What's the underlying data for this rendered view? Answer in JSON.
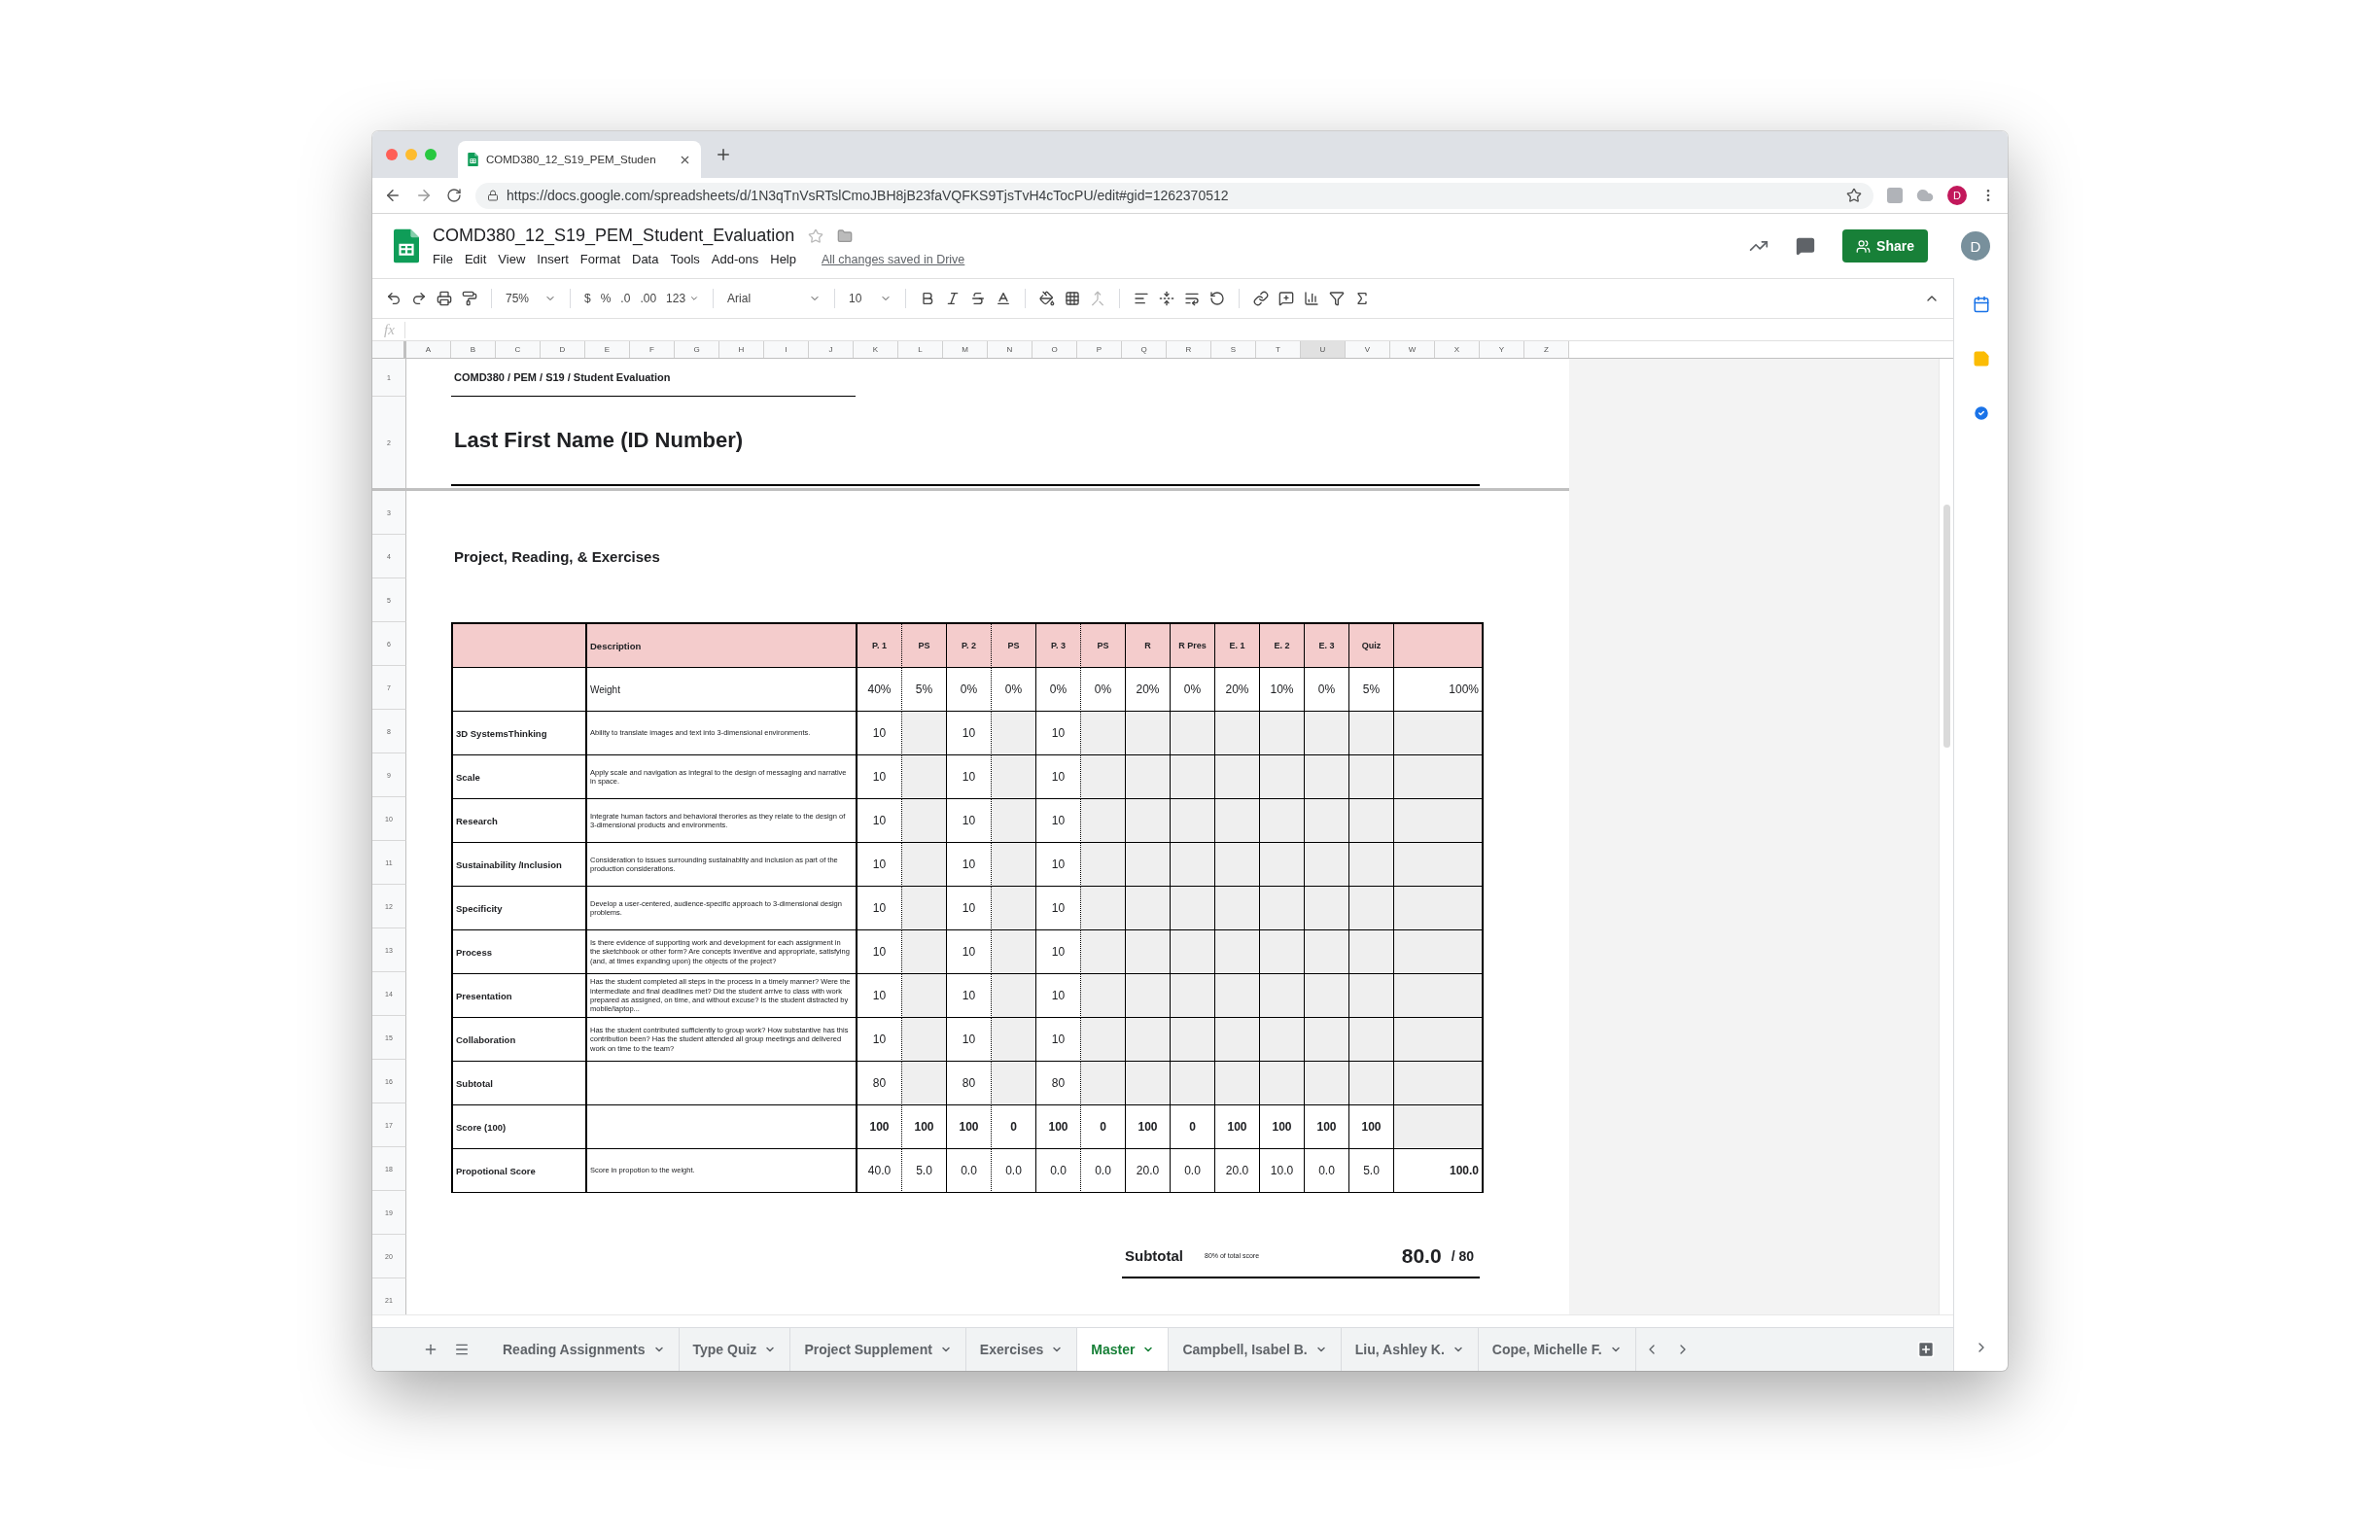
{
  "browser": {
    "tab_title": "COMD380_12_S19_PEM_Studen",
    "url": "https://docs.google.com/spreadsheets/d/1N3qTnVsRTslCmoJBH8jB23faVQFKS9TjsTvH4cTocPU/edit#gid=1262370512",
    "profile": "D"
  },
  "document": {
    "title": "COMD380_12_S19_PEM_Student_Evaluation",
    "starred": false,
    "menus": [
      "File",
      "Edit",
      "View",
      "Insert",
      "Format",
      "Data",
      "Tools",
      "Add-ons",
      "Help"
    ],
    "save_status": "All changes saved in Drive",
    "share_label": "Share",
    "avatar": "D"
  },
  "toolbar": {
    "zoom": "75%",
    "currency": "$",
    "percent": "%",
    "decimal_decrease": ".0",
    "decimal_increase": ".00",
    "number_format": "123",
    "font": "Arial",
    "font_size": "10"
  },
  "formula_bar": {
    "label": "fx"
  },
  "columns": [
    {
      "label": "A",
      "selected": false
    },
    {
      "label": "B",
      "selected": false
    },
    {
      "label": "C",
      "selected": false
    },
    {
      "label": "D",
      "selected": false
    },
    {
      "label": "E",
      "selected": false
    },
    {
      "label": "F",
      "selected": false
    },
    {
      "label": "G",
      "selected": false
    },
    {
      "label": "H",
      "selected": false
    },
    {
      "label": "I",
      "selected": false
    },
    {
      "label": "J",
      "selected": false
    },
    {
      "label": "K",
      "selected": false
    },
    {
      "label": "L",
      "selected": false
    },
    {
      "label": "M",
      "selected": false
    },
    {
      "label": "N",
      "selected": false
    },
    {
      "label": "O",
      "selected": false
    },
    {
      "label": "P",
      "selected": false
    },
    {
      "label": "Q",
      "selected": false
    },
    {
      "label": "R",
      "selected": false
    },
    {
      "label": "S",
      "selected": false
    },
    {
      "label": "T",
      "selected": false
    },
    {
      "label": "U",
      "selected": true
    },
    {
      "label": "V",
      "selected": false
    },
    {
      "label": "W",
      "selected": false
    },
    {
      "label": "X",
      "selected": false
    },
    {
      "label": "Y",
      "selected": false
    },
    {
      "label": "Z",
      "selected": false
    }
  ],
  "row_numbers": [
    "1",
    "2",
    "3",
    "4",
    "5",
    "6",
    "7",
    "8",
    "9",
    "10",
    "11",
    "12",
    "13",
    "14",
    "15",
    "16",
    "17",
    "18",
    "19",
    "20",
    "21"
  ],
  "sheet": {
    "breadcrumb": "COMD380 / PEM / S19 / Student Evaluation",
    "student_name": "Last First Name (ID Number)",
    "section_title": "Project, Reading, & Exercises",
    "table": {
      "header": {
        "description": "Description",
        "columns": [
          {
            "label": "P. 1",
            "kind": "project"
          },
          {
            "label": "PS",
            "kind": "supplement"
          },
          {
            "label": "P. 2",
            "kind": "project"
          },
          {
            "label": "PS",
            "kind": "supplement"
          },
          {
            "label": "P. 3",
            "kind": "project"
          },
          {
            "label": "PS",
            "kind": "supplement"
          },
          {
            "label": "R",
            "kind": "single"
          },
          {
            "label": "R Pres",
            "kind": "single"
          },
          {
            "label": "E. 1",
            "kind": "single"
          },
          {
            "label": "E. 2",
            "kind": "single"
          },
          {
            "label": "E. 3",
            "kind": "single"
          },
          {
            "label": "Quiz",
            "kind": "single"
          },
          {
            "kind": "total"
          }
        ]
      },
      "rows": [
        {
          "kind": "weight",
          "description": "Weight",
          "values": [
            "40%",
            "5%",
            "0%",
            "0%",
            "0%",
            "0%",
            "20%",
            "0%",
            "20%",
            "10%",
            "0%",
            "5%",
            "100%"
          ]
        },
        {
          "kind": "criterion",
          "label": "3D SystemsThinking",
          "description": "Ability to translate images and text into 3-dimensional environments.",
          "values": [
            "10",
            {
              "kind": "blank"
            },
            "10",
            {
              "kind": "blank"
            },
            "10",
            {
              "kind": "blank"
            },
            {
              "kind": "blank"
            },
            {
              "kind": "blank"
            },
            {
              "kind": "blank"
            },
            {
              "kind": "blank"
            },
            {
              "kind": "blank"
            },
            {
              "kind": "blank"
            },
            {
              "kind": "blank"
            }
          ]
        },
        {
          "kind": "criterion",
          "label": "Scale",
          "description": "Apply scale and navigation as integral to the design of messaging and narrative in space.",
          "values": [
            "10",
            {
              "kind": "blank"
            },
            "10",
            {
              "kind": "blank"
            },
            "10",
            {
              "kind": "blank"
            },
            {
              "kind": "blank"
            },
            {
              "kind": "blank"
            },
            {
              "kind": "blank"
            },
            {
              "kind": "blank"
            },
            {
              "kind": "blank"
            },
            {
              "kind": "blank"
            },
            {
              "kind": "blank"
            }
          ]
        },
        {
          "kind": "criterion",
          "label": "Research",
          "description": "Integrate human factors and behavioral therories as they relate to the design of 3-dimensional products and environments.",
          "values": [
            "10",
            {
              "kind": "blank"
            },
            "10",
            {
              "kind": "blank"
            },
            "10",
            {
              "kind": "blank"
            },
            {
              "kind": "blank"
            },
            {
              "kind": "blank"
            },
            {
              "kind": "blank"
            },
            {
              "kind": "blank"
            },
            {
              "kind": "blank"
            },
            {
              "kind": "blank"
            },
            {
              "kind": "blank"
            }
          ]
        },
        {
          "kind": "criterion",
          "label": "Sustainability /Inclusion",
          "description": "Consideration to issues surrounding sustainablity and inclusion as part of the production considerations.",
          "values": [
            "10",
            {
              "kind": "blank"
            },
            "10",
            {
              "kind": "blank"
            },
            "10",
            {
              "kind": "blank"
            },
            {
              "kind": "blank"
            },
            {
              "kind": "blank"
            },
            {
              "kind": "blank"
            },
            {
              "kind": "blank"
            },
            {
              "kind": "blank"
            },
            {
              "kind": "blank"
            },
            {
              "kind": "blank"
            }
          ]
        },
        {
          "kind": "criterion",
          "label": "Specificity",
          "description": "Develop a user-centered, audience-specific approach to 3-dimensional design problems.",
          "values": [
            "10",
            {
              "kind": "blank"
            },
            "10",
            {
              "kind": "blank"
            },
            "10",
            {
              "kind": "blank"
            },
            {
              "kind": "blank"
            },
            {
              "kind": "blank"
            },
            {
              "kind": "blank"
            },
            {
              "kind": "blank"
            },
            {
              "kind": "blank"
            },
            {
              "kind": "blank"
            },
            {
              "kind": "blank"
            }
          ]
        },
        {
          "kind": "criterion",
          "label": "Process",
          "description": "Is there evidence of supporting work and development for each assignment in the sketchbook or other form? Are concepts inventive and appropriate, satisfying (and, at times expanding upon) the objects of the project?",
          "values": [
            "10",
            {
              "kind": "blank"
            },
            "10",
            {
              "kind": "blank"
            },
            "10",
            {
              "kind": "blank"
            },
            {
              "kind": "blank"
            },
            {
              "kind": "blank"
            },
            {
              "kind": "blank"
            },
            {
              "kind": "blank"
            },
            {
              "kind": "blank"
            },
            {
              "kind": "blank"
            },
            {
              "kind": "blank"
            }
          ]
        },
        {
          "kind": "criterion",
          "label": "Presentation",
          "description": "Has the student completed all steps in the process in a timely manner? Were the intermediate and final deadlines met? Did the student arrive to class with work prepared as assigned, on time, and without excuse? Is the student distracted by mobile/laptop...",
          "values": [
            "10",
            {
              "kind": "blank"
            },
            "10",
            {
              "kind": "blank"
            },
            "10",
            {
              "kind": "blank"
            },
            {
              "kind": "blank"
            },
            {
              "kind": "blank"
            },
            {
              "kind": "blank"
            },
            {
              "kind": "blank"
            },
            {
              "kind": "blank"
            },
            {
              "kind": "blank"
            },
            {
              "kind": "blank"
            }
          ]
        },
        {
          "kind": "criterion",
          "label": "Collaboration",
          "description": "Has the student contributed sufficiently to group work? How substantive has this contribution been? Has the student attended all group meetings and delivered work on time to the team?",
          "values": [
            "10",
            {
              "kind": "blank"
            },
            "10",
            {
              "kind": "blank"
            },
            "10",
            {
              "kind": "blank"
            },
            {
              "kind": "blank"
            },
            {
              "kind": "blank"
            },
            {
              "kind": "blank"
            },
            {
              "kind": "blank"
            },
            {
              "kind": "blank"
            },
            {
              "kind": "blank"
            },
            {
              "kind": "blank"
            }
          ]
        },
        {
          "kind": "subtotal",
          "label": "Subtotal",
          "values": [
            "80",
            {
              "kind": "blank"
            },
            "80",
            {
              "kind": "blank"
            },
            "80",
            {
              "kind": "blank"
            },
            {
              "kind": "blank"
            },
            {
              "kind": "blank"
            },
            {
              "kind": "blank"
            },
            {
              "kind": "blank"
            },
            {
              "kind": "blank"
            },
            {
              "kind": "blank"
            },
            {
              "kind": "blank"
            }
          ]
        },
        {
          "kind": "score",
          "label": "Score (100)",
          "values": [
            "100",
            "100",
            "100",
            "0",
            "100",
            "0",
            "100",
            "0",
            "100",
            "100",
            "100",
            "100",
            {
              "kind": "blank"
            }
          ]
        },
        {
          "kind": "proportional",
          "label": "Propotional Score",
          "description": "Score in propotion to the weight.",
          "values": [
            "40.0",
            "5.0",
            "0.0",
            "0.0",
            "0.0",
            "0.0",
            "20.0",
            "0.0",
            "20.0",
            "10.0",
            "0.0",
            "5.0",
            "100.0"
          ]
        }
      ]
    },
    "subtotal": {
      "label": "Subtotal",
      "note": "80% of total score",
      "value": "80.0",
      "out_of": "/ 80"
    }
  },
  "sheet_tabs": [
    {
      "label": "Reading Assignments",
      "selected": false
    },
    {
      "label": "Type Quiz",
      "selected": false
    },
    {
      "label": "Project Supplement",
      "selected": false
    },
    {
      "label": "Exercises",
      "selected": false
    },
    {
      "label": "Master",
      "selected": true
    },
    {
      "label": "Campbell, Isabel B.",
      "selected": false
    },
    {
      "label": "Liu, Ashley K.",
      "selected": false
    },
    {
      "label": "Cope, Michelle F.",
      "selected": false
    }
  ]
}
